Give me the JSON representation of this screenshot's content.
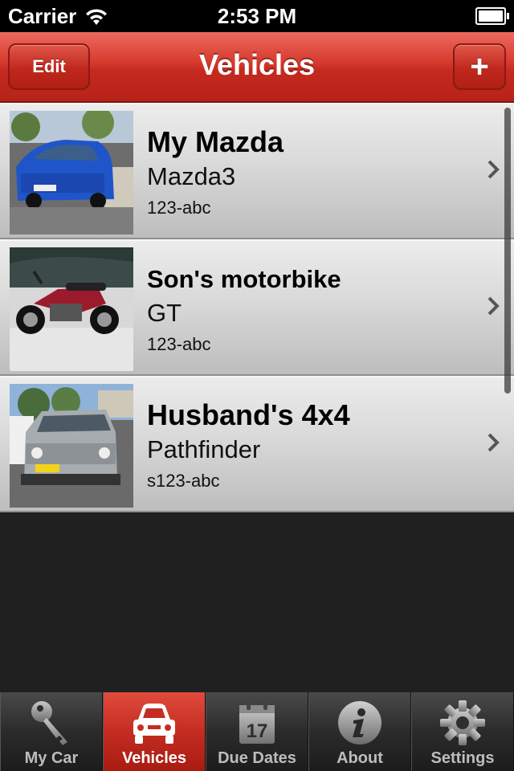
{
  "status": {
    "carrier": "Carrier",
    "time": "2:53 PM"
  },
  "nav": {
    "title": "Vehicles",
    "edit_label": "Edit",
    "add_label": "+"
  },
  "vehicles": [
    {
      "name": "My Mazda",
      "model": "Mazda3",
      "plate": "123-abc",
      "photo": "blue-hatchback-photo"
    },
    {
      "name": "Son's motorbike",
      "model": "GT",
      "plate": "123-abc",
      "photo": "red-motorbike-photo"
    },
    {
      "name": "Husband's 4x4",
      "model": "Pathfinder",
      "plate": "s123-abc",
      "photo": "silver-4x4-photo"
    }
  ],
  "tabs": [
    {
      "label": "My Car",
      "icon": "key-icon",
      "selected": false
    },
    {
      "label": "Vehicles",
      "icon": "car-icon",
      "selected": true
    },
    {
      "label": "Due Dates",
      "icon": "calendar-icon",
      "selected": false,
      "calendar_day": "17"
    },
    {
      "label": "About",
      "icon": "info-icon",
      "selected": false
    },
    {
      "label": "Settings",
      "icon": "gear-icon",
      "selected": false
    }
  ],
  "colors": {
    "accent": "#c62a1f",
    "list_bg": "#202020"
  }
}
